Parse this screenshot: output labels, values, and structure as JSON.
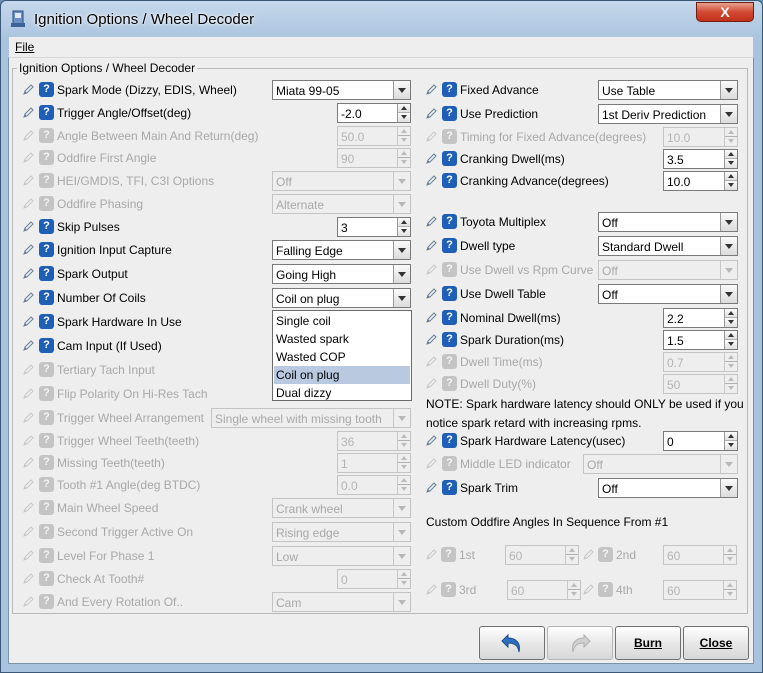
{
  "window": {
    "title": "Ignition Options / Wheel Decoder",
    "close_label": "X"
  },
  "menu": {
    "file": "File"
  },
  "group": {
    "title": "Ignition Options / Wheel Decoder"
  },
  "left": [
    {
      "label": "Spark Mode (Dizzy, EDIS, Wheel)",
      "enabled": true,
      "type": "combo",
      "value": "Miata 99-05"
    },
    {
      "label": "Trigger Angle/Offset(deg)",
      "enabled": true,
      "type": "spin",
      "value": "-2.0"
    },
    {
      "label": "Angle Between Main And Return(deg)",
      "enabled": false,
      "type": "spin",
      "value": "50.0"
    },
    {
      "label": "Oddfire First Angle",
      "enabled": false,
      "type": "spin",
      "value": "90"
    },
    {
      "label": "HEI/GMDIS, TFI, C3I Options",
      "enabled": false,
      "type": "combo",
      "value": "Off"
    },
    {
      "label": "Oddfire Phasing",
      "enabled": false,
      "type": "combo",
      "value": "Alternate"
    },
    {
      "label": "Skip Pulses",
      "enabled": true,
      "type": "spin",
      "value": "3"
    },
    {
      "label": "Ignition Input Capture",
      "enabled": true,
      "type": "combo",
      "value": "Falling Edge"
    },
    {
      "label": "Spark Output",
      "enabled": true,
      "type": "combo",
      "value": "Going High"
    },
    {
      "label": "Number Of Coils",
      "enabled": true,
      "type": "combo",
      "value": "Coil on plug"
    },
    {
      "label": "Spark Hardware In Use",
      "enabled": true,
      "type": "none",
      "value": ""
    },
    {
      "label": "Cam Input (If Used)",
      "enabled": true,
      "type": "none",
      "value": ""
    },
    {
      "label": "Tertiary Tach Input",
      "enabled": false,
      "type": "none",
      "value": ""
    },
    {
      "label": "Flip Polarity On Hi-Res Tach",
      "enabled": false,
      "type": "none",
      "value": ""
    },
    {
      "label": "Trigger Wheel Arrangement",
      "enabled": false,
      "type": "combo",
      "value": "Single wheel with missing tooth"
    },
    {
      "label": "Trigger Wheel Teeth(teeth)",
      "enabled": false,
      "type": "spin",
      "value": "36"
    },
    {
      "label": "Missing Teeth(teeth)",
      "enabled": false,
      "type": "spin",
      "value": "1"
    },
    {
      "label": "Tooth #1 Angle(deg BTDC)",
      "enabled": false,
      "type": "spin",
      "value": "0.0"
    },
    {
      "label": "Main Wheel Speed",
      "enabled": false,
      "type": "combo",
      "value": "Crank wheel"
    },
    {
      "label": "Second Trigger Active On",
      "enabled": false,
      "type": "combo",
      "value": "Rising edge"
    },
    {
      "label": "Level For Phase 1",
      "enabled": false,
      "type": "combo",
      "value": "Low"
    },
    {
      "label": "Check At Tooth#",
      "enabled": false,
      "type": "spin",
      "value": "0"
    },
    {
      "label": "And Every Rotation Of..",
      "enabled": false,
      "type": "combo",
      "value": "Cam"
    }
  ],
  "coil_dropdown": {
    "options": [
      "Single coil",
      "Wasted spark",
      "Wasted COP",
      "Coil on plug",
      "Dual dizzy"
    ],
    "selected": "Coil on plug"
  },
  "right": [
    {
      "label": "Fixed Advance",
      "enabled": true,
      "type": "combo",
      "value": "Use Table"
    },
    {
      "label": "Use Prediction",
      "enabled": true,
      "type": "combo",
      "value": "1st Deriv Prediction"
    },
    {
      "label": "Timing for Fixed Advance(degrees)",
      "enabled": false,
      "type": "spin",
      "value": "10.0"
    },
    {
      "label": "Cranking Dwell(ms)",
      "enabled": true,
      "type": "spin",
      "value": "3.5"
    },
    {
      "label": "Cranking Advance(degrees)",
      "enabled": true,
      "type": "spin",
      "value": "10.0"
    },
    {
      "label": "Toyota Multiplex",
      "enabled": true,
      "type": "combo",
      "value": "Off"
    },
    {
      "label": "Dwell type",
      "enabled": true,
      "type": "combo",
      "value": "Standard Dwell"
    },
    {
      "label": "Use Dwell vs Rpm Curve",
      "enabled": false,
      "type": "combo",
      "value": "Off"
    },
    {
      "label": "Use Dwell Table",
      "enabled": true,
      "type": "combo",
      "value": "Off"
    },
    {
      "label": "Nominal Dwell(ms)",
      "enabled": true,
      "type": "spin",
      "value": "2.2"
    },
    {
      "label": "Spark Duration(ms)",
      "enabled": true,
      "type": "spin",
      "value": "1.5"
    },
    {
      "label": "Dwell Time(ms)",
      "enabled": false,
      "type": "spin",
      "value": "0.7"
    },
    {
      "label": "Dwell Duty(%)",
      "enabled": false,
      "type": "spin",
      "value": "50"
    },
    {
      "label": "Spark Hardware Latency(usec)",
      "enabled": true,
      "type": "spin",
      "value": "0"
    },
    {
      "label": "Middle LED indicator",
      "enabled": false,
      "type": "combo",
      "value": "Off"
    },
    {
      "label": "Spark Trim",
      "enabled": true,
      "type": "combo",
      "value": "Off"
    }
  ],
  "note": "NOTE: Spark hardware latency should ONLY be used if you notice spark retard with increasing rpms.",
  "oddfire": {
    "heading": "Custom Oddfire Angles In Sequence From #1",
    "fields": [
      {
        "label": "1st",
        "value": "60"
      },
      {
        "label": "2nd",
        "value": "60"
      },
      {
        "label": "3rd",
        "value": "60"
      },
      {
        "label": "4th",
        "value": "60"
      }
    ]
  },
  "buttons": {
    "undo": "undo-icon",
    "redo": "redo-icon",
    "burn": "Burn",
    "close": "Close"
  },
  "colors": {
    "help_icon": "#1f5fb8",
    "selection": "#b9c9e0",
    "title_close": "#d24a32"
  }
}
